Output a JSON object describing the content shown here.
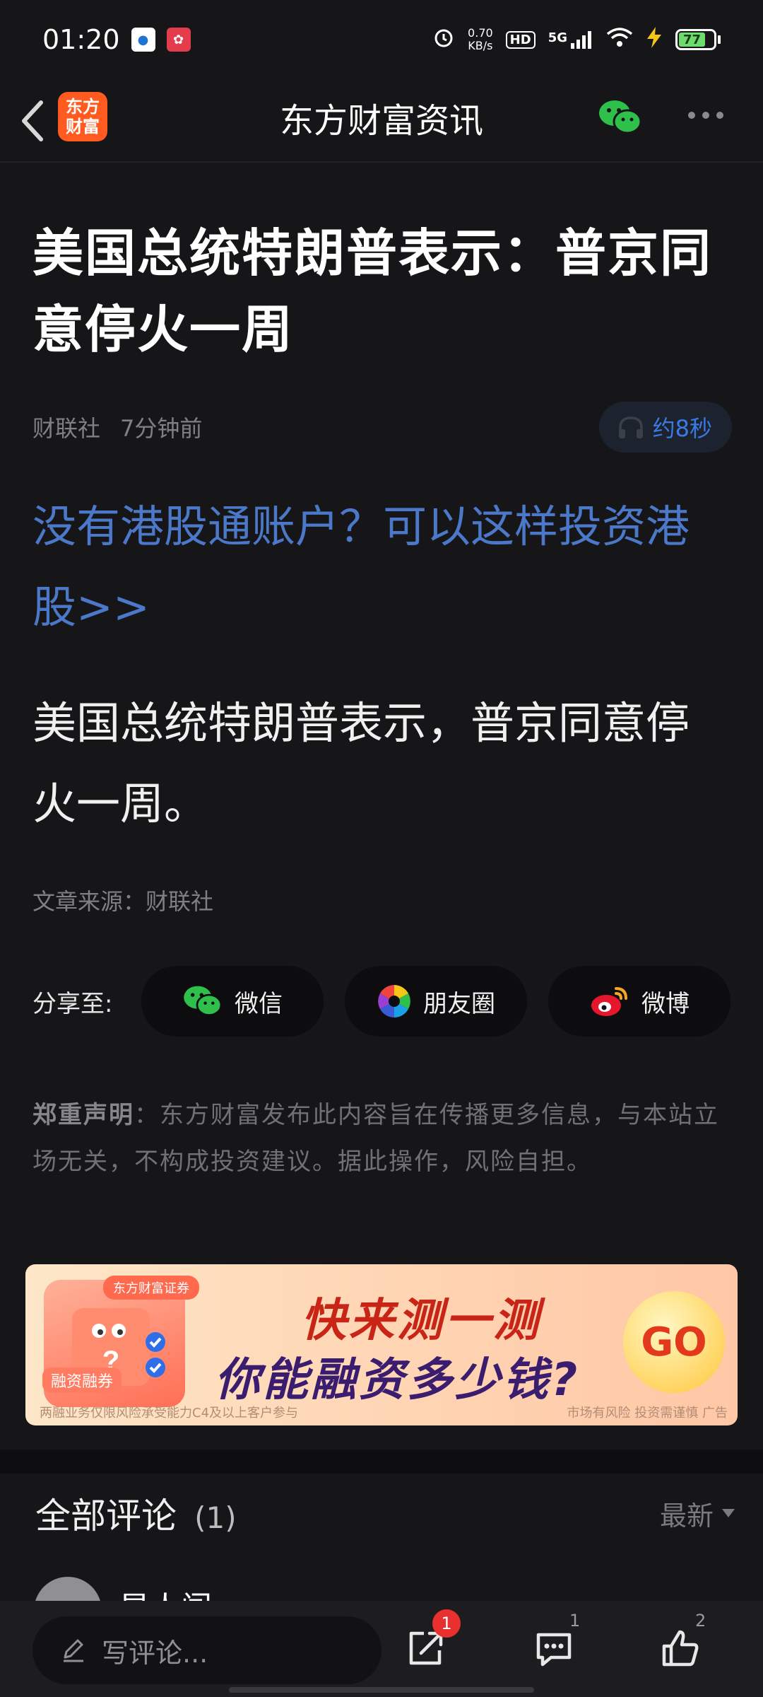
{
  "status_bar": {
    "time": "01:20",
    "net_speed_value": "0.70",
    "net_speed_unit": "KB/s",
    "hd": "HD",
    "network": "5G",
    "battery": "77"
  },
  "nav": {
    "brand_line1": "东方",
    "brand_line2": "财富",
    "title": "东方财富资讯"
  },
  "article": {
    "headline": "美国总统特朗普表示：普京同意停火一周",
    "source": "财联社",
    "time_ago": "7分钟前",
    "audio_duration": "约8秒",
    "promo_link": "没有港股通账户？可以这样投资港股>>",
    "body": "美国总统特朗普表示，普京同意停火一周。",
    "source_line": "文章来源：财联社"
  },
  "share": {
    "label": "分享至:",
    "buttons": [
      {
        "label": "微信"
      },
      {
        "label": "朋友圈"
      },
      {
        "label": "微博"
      }
    ]
  },
  "disclaimer": {
    "title": "郑重声明",
    "text": "：东方财富发布此内容旨在传播更多信息，与本站立场无关，不构成投资建议。据此操作，风险自担。"
  },
  "ad": {
    "badge": "东方财富证券",
    "tag": "融资融券",
    "line1": "快来测一测",
    "line2": "你能融资多少钱?",
    "go": "GO",
    "foot_left": "两融业务仅限风险承受能力C4及以上客户参与",
    "foot_right": "市场有风险 投资需谨慎 广告"
  },
  "comments": {
    "title": "全部评论",
    "count": "(1)",
    "sort": "最新",
    "first_name": "星人闯"
  },
  "bottom_bar": {
    "input_placeholder": "写评论...",
    "share_badge": "1",
    "comment_count": "1",
    "like_count": "2"
  },
  "colors": {
    "background": "#161618",
    "link_blue": "#4b78c9",
    "brand_orange": "#ff5a1f",
    "wechat_green": "#2fbf4b",
    "badge_red": "#e8312e"
  }
}
